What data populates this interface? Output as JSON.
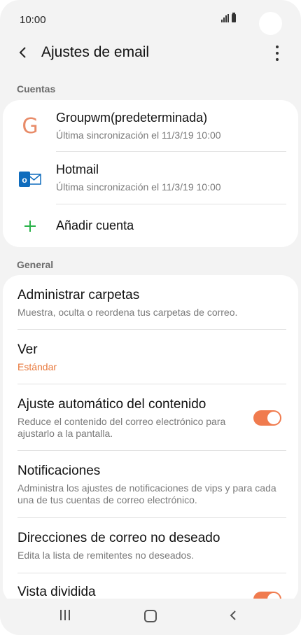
{
  "status_bar": {
    "time": "10:00"
  },
  "header": {
    "title": "Ajustes de email"
  },
  "accounts_section": {
    "header": "Cuentas",
    "accounts": [
      {
        "name": "Groupwm(predeterminada)",
        "sync": "Última sincronización el 11/3/19  10:00",
        "icon": "google-g-icon"
      },
      {
        "name": "Hotmail",
        "sync": "Última sincronización el 11/3/19  10:00",
        "icon": "outlook-icon"
      }
    ],
    "add_account": "Añadir cuenta"
  },
  "general_section": {
    "header": "General",
    "items": [
      {
        "title": "Administrar carpetas",
        "subtitle": "Muestra, oculta o reordena tus carpetas de correo."
      },
      {
        "title": "Ver",
        "subtitle": "Estándar"
      },
      {
        "title": "Ajuste automático del contenido",
        "subtitle": "Reduce el contenido del correo electrónico para ajustarlo a la pantalla.",
        "toggle": true
      },
      {
        "title": "Notificaciones",
        "subtitle": "Administra los ajustes de notificaciones de vips y para cada una de tus cuentas de correo electrónico."
      },
      {
        "title": "Direcciones de correo no deseado",
        "subtitle": "Edita la lista de remitentes no deseados."
      },
      {
        "title": "Vista dividida",
        "toggle": true
      }
    ]
  },
  "colors": {
    "accent": "#e8773a",
    "toggle_on": "#f07b4e",
    "add_plus": "#2bb34a",
    "google_g": "#e88b68",
    "outlook": "#0f6cbd"
  }
}
